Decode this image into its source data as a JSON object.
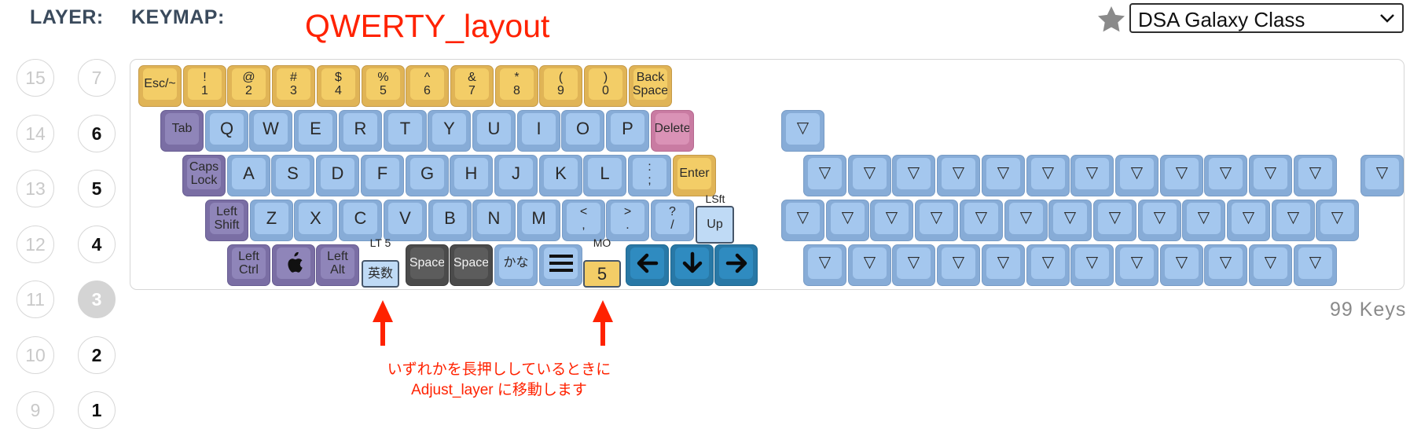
{
  "header": {
    "layer_label": "LAYER:",
    "keymap_label": "KEYMAP:",
    "keymap_title": "QWERTY_layout",
    "keyset_select": "DSA Galaxy Class",
    "favorite_icon": "star-icon",
    "select_icon": "chevron-down-icon"
  },
  "layers": {
    "left": [
      "15",
      "14",
      "13",
      "12",
      "11",
      "10",
      "9"
    ],
    "right": [
      "7",
      "6",
      "5",
      "4",
      "3",
      "2",
      "1"
    ],
    "selected": "3"
  },
  "keyboard": {
    "row1": [
      "Esc/~",
      "!|1",
      "@|2",
      "#|3",
      "$|4",
      "%|5",
      "^|6",
      "&|7",
      "*|8",
      "(|9",
      ")|0",
      "Back|Space"
    ],
    "row2": [
      "Tab",
      "Q",
      "W",
      "E",
      "R",
      "T",
      "Y",
      "U",
      "I",
      "O",
      "P",
      "Delete"
    ],
    "row3": [
      "Caps|Lock",
      "A",
      "S",
      "D",
      "F",
      "G",
      "H",
      "J",
      "K",
      "L",
      ":|;",
      "Enter"
    ],
    "row4": [
      "Left|Shift",
      "Z",
      "X",
      "C",
      "V",
      "B",
      "N",
      "M",
      "<|,",
      ">|.",
      "?|/",
      "Up"
    ],
    "row5": [
      "Left|Ctrl",
      "",
      "Left|Alt",
      "英数",
      "Space",
      "Space",
      "かな",
      "",
      "5",
      "",
      "",
      ""
    ],
    "row5_icons": {
      "apple": "apple-icon",
      "menu": "menu-icon",
      "left": "arrow-left-icon",
      "down": "arrow-down-icon",
      "right": "arrow-right-icon"
    },
    "top_labels": {
      "up": "LSft",
      "eisu": "LT 5",
      "mo": "MO"
    },
    "transparent_symbol": "▽"
  },
  "keys_count": "99 Keys",
  "annotation": [
    "いずれかを長押ししているときに",
    "Adjust_layer に移動します"
  ],
  "colors": {
    "accent_red": "#ff2200",
    "key_yellow": "#f3cd67",
    "key_blue": "#a4c7ee",
    "key_purple": "#8f85b9",
    "key_pink": "#da92b6",
    "key_dark": "#5c5c5c",
    "key_teal": "#2f8bc0"
  }
}
